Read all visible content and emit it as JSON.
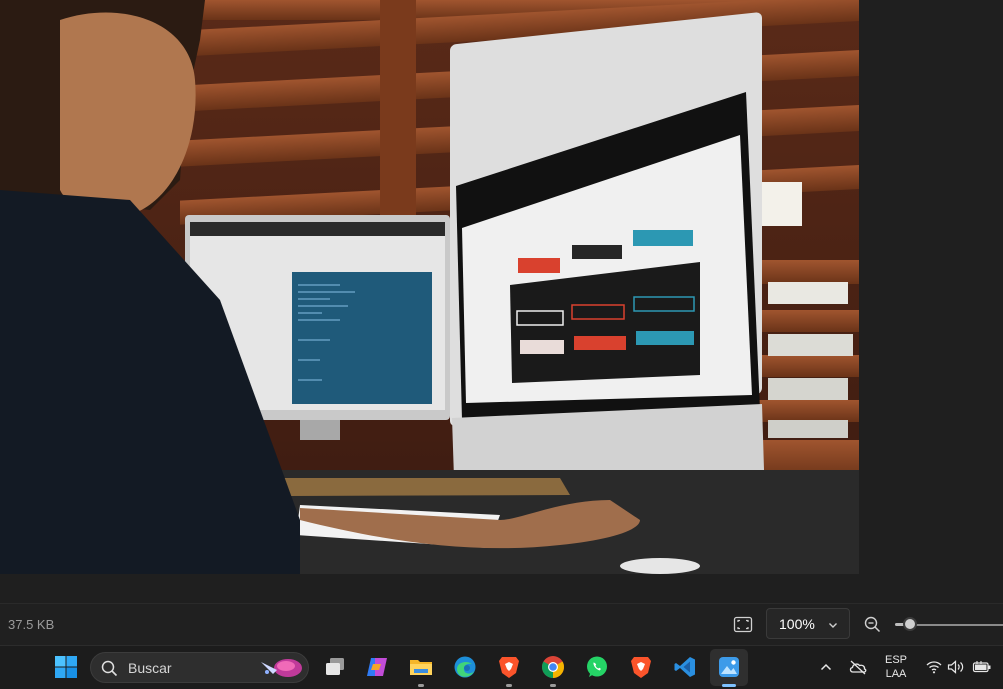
{
  "viewer": {
    "photo_description_icon": "photo"
  },
  "statusbar": {
    "file_size": "37.5 KB",
    "zoom_level": "100%",
    "zoom_fraction": 0.15
  },
  "taskbar": {
    "search_placeholder": "Buscar",
    "apps": [
      "start-icon",
      "task-view-icon",
      "copilot-icon",
      "file-explorer-icon",
      "edge-icon",
      "brave-icon",
      "chrome-icon",
      "whatsapp-icon",
      "brave-icon",
      "vscode-icon",
      "photos-icon"
    ],
    "language_line1": "ESP",
    "language_line2": "LAA"
  },
  "colors": {
    "background": "#1f1f1f",
    "taskbar": "#1c1c1c",
    "accent_blue": "#0078d4"
  }
}
